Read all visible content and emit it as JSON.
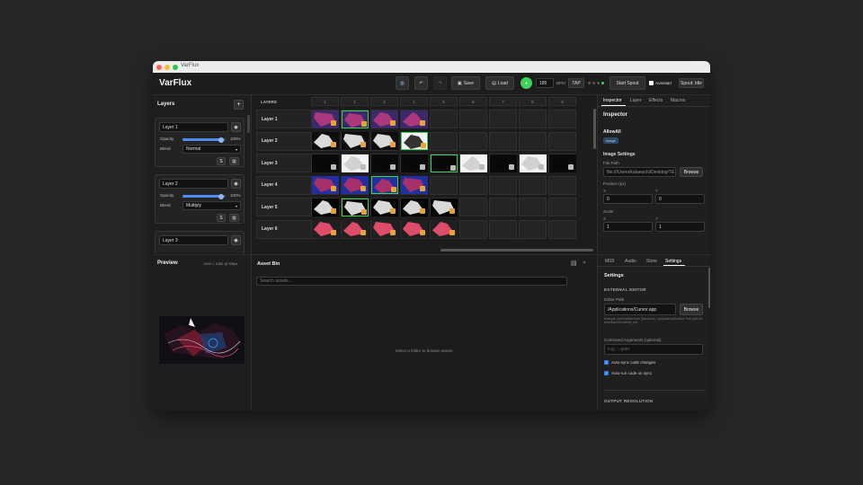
{
  "window": {
    "title": "VarFlux"
  },
  "toolbar": {
    "app_name": "VarFlux",
    "save": "Save",
    "load": "Load",
    "bpm_value": "185",
    "bpm_label": "BPM",
    "tap": "TAP",
    "start_spout": "Start Spout",
    "autostart": "Autostart",
    "spout_status": "Spout: Idle"
  },
  "layers": {
    "title": "Layers",
    "add": "+",
    "opacity_label": "Opacity",
    "blend_label": "Blend",
    "solo": "S",
    "items": [
      {
        "name": "Layer 1",
        "opacity": "100%",
        "blend": "Normal",
        "opacity_fraction": 0.9
      },
      {
        "name": "Layer 2",
        "opacity": "100%",
        "blend": "Multiply",
        "opacity_fraction": 0.9
      },
      {
        "name": "Layer 3"
      }
    ]
  },
  "grid": {
    "header": "LAYERS",
    "columns": [
      "1",
      "2",
      "3",
      "4",
      "5",
      "6",
      "7",
      "8",
      "9"
    ],
    "rows": [
      "Layer 1",
      "Layer 2",
      "Layer 3",
      "Layer 4",
      "Layer 5",
      "Layer 6"
    ]
  },
  "preview": {
    "title": "Preview",
    "resolution": "1920 × 1080 @ 60fps"
  },
  "asset_bin": {
    "title": "Asset Bin",
    "search_placeholder": "Search assets...",
    "empty_message": "Select a folder to browse assets"
  },
  "inspector": {
    "tabs": [
      "Inspector",
      "Layer",
      "Effects",
      "Macros"
    ],
    "title": "Inspector",
    "clip_name": "AllowAll",
    "clip_tag": "image",
    "section": "Image Settings",
    "file_path_label": "File Path",
    "file_path": "file:///Users/kataeuchi/Desktop/TE",
    "browse": "Browse",
    "position_label": "Position (px)",
    "x_label": "X",
    "y_label": "Y",
    "pos_x": "0",
    "pos_y": "0",
    "scale_label": "Scale",
    "scale_x": "1",
    "scale_y": "1"
  },
  "settings": {
    "tabs": [
      "MIDI",
      "Audio",
      "Store",
      "Settings"
    ],
    "title": "Settings",
    "external_editor": "EXTERNAL EDITOR",
    "editor_path_label": "Editor Path",
    "editor_path": "/Applications/Cursor.app",
    "browse": "Browse",
    "editor_hint": "Example: /usr/local/bin/code (Mac/Linux), /Applications/Sublime Text.app/Contents/MacOS/sublime_text",
    "args_label": "Command Arguments (optional)",
    "args_placeholder": "e.g.: --goto",
    "auto_sync": "Auto-sync code changes",
    "auto_run": "Auto-run code on sync",
    "output_resolution": "OUTPUT RESOLUTION"
  },
  "colors": {
    "accent_green": "#3fd25a",
    "accent_blue": "#2f7df6",
    "bg": "#1b1b1b"
  }
}
